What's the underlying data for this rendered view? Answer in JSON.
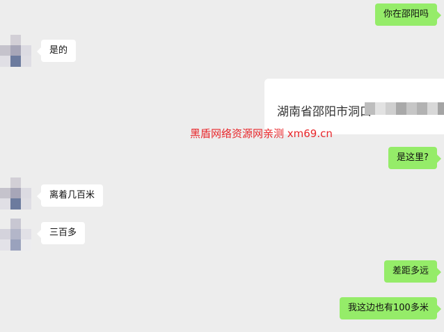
{
  "messages": [
    {
      "side": "right",
      "text": "你在邵阳吗"
    },
    {
      "side": "left",
      "text": "是的"
    },
    {
      "side": "right",
      "text": "湖南省邵阳市洞口"
    },
    {
      "side": "right",
      "text": "是这里?"
    },
    {
      "side": "left",
      "text": "离着几百米"
    },
    {
      "side": "left",
      "text": "三百多"
    },
    {
      "side": "right",
      "text": "差距多远"
    },
    {
      "side": "right",
      "text": "我这边也有100多米"
    }
  ],
  "watermark": "黑盾网络资源网亲测 xm69.cn",
  "colors": {
    "self_bubble": "#95ec69",
    "other_bubble": "#ffffff",
    "background": "#ededed",
    "watermark": "#e8262a"
  }
}
